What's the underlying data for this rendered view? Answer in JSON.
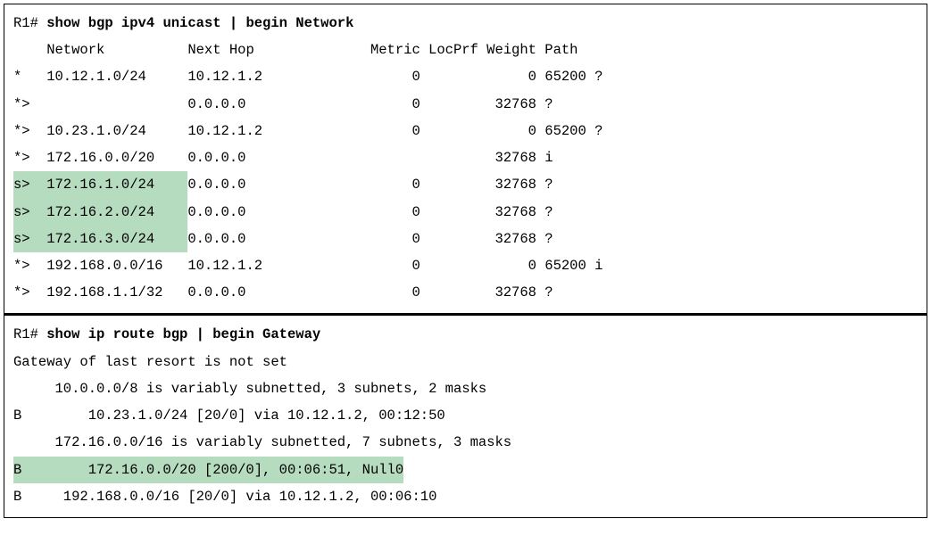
{
  "section1": {
    "prompt": "R1#",
    "command": "show bgp ipv4 unicast | begin Network",
    "headers": {
      "network": "Network",
      "nexthop": "Next Hop",
      "metric": "Metric",
      "locprf": "LocPrf",
      "weight": "Weight",
      "path": "Path"
    },
    "rows": [
      {
        "status": " *",
        "network": "10.12.1.0/24",
        "nexthop": "10.12.1.2",
        "metric": "0",
        "locprf": "",
        "weight": "0",
        "path": "65200 ?",
        "highlight": false
      },
      {
        "status": " *>",
        "network": "",
        "nexthop": "0.0.0.0",
        "metric": "0",
        "locprf": "",
        "weight": "32768",
        "path": "?",
        "highlight": false
      },
      {
        "status": " *>",
        "network": "10.23.1.0/24",
        "nexthop": "10.12.1.2",
        "metric": "0",
        "locprf": "",
        "weight": "0",
        "path": "65200 ?",
        "highlight": false
      },
      {
        "status": " *>",
        "network": "172.16.0.0/20",
        "nexthop": "0.0.0.0",
        "metric": "",
        "locprf": "",
        "weight": "32768",
        "path": "i",
        "highlight": false
      },
      {
        "status": " s>",
        "network": "172.16.1.0/24",
        "nexthop": "0.0.0.0",
        "metric": "0",
        "locprf": "",
        "weight": "32768",
        "path": "?",
        "highlight": true
      },
      {
        "status": " s>",
        "network": "172.16.2.0/24",
        "nexthop": "0.0.0.0",
        "metric": "0",
        "locprf": "",
        "weight": "32768",
        "path": "?",
        "highlight": true
      },
      {
        "status": " s>",
        "network": "172.16.3.0/24",
        "nexthop": "0.0.0.0",
        "metric": "0",
        "locprf": "",
        "weight": "32768",
        "path": "?",
        "highlight": true
      },
      {
        "status": " *>",
        "network": "192.168.0.0/16",
        "nexthop": "10.12.1.2",
        "metric": "0",
        "locprf": "",
        "weight": "0",
        "path": "65200 i",
        "highlight": false
      },
      {
        "status": " *>",
        "network": "192.168.1.1/32",
        "nexthop": "0.0.0.0",
        "metric": "0",
        "locprf": "",
        "weight": "32768",
        "path": "?",
        "highlight": false
      }
    ]
  },
  "section2": {
    "prompt": "R1#",
    "command": "show ip route bgp | begin Gateway",
    "lines": [
      {
        "text": "Gateway of last resort is not set",
        "code": "",
        "highlight": false,
        "indent": "none"
      },
      {
        "text": "10.0.0.0/8 is variably subnetted, 3 subnets, 2 masks",
        "code": "",
        "highlight": false,
        "indent": "sm"
      },
      {
        "text": "10.23.1.0/24 [20/0] via 10.12.1.2, 00:12:50",
        "code": "B",
        "highlight": false,
        "indent": "bgp"
      },
      {
        "text": "172.16.0.0/16 is variably subnetted, 7 subnets, 3 masks",
        "code": "",
        "highlight": false,
        "indent": "sm"
      },
      {
        "text": "172.16.0.0/20 [200/0], 00:06:51, Null0",
        "code": "B",
        "highlight": true,
        "indent": "bgp"
      },
      {
        "text": "192.168.0.0/16 [20/0] via 10.12.1.2, 00:06:10",
        "code": "B",
        "highlight": false,
        "indent": "bgp2"
      }
    ]
  }
}
